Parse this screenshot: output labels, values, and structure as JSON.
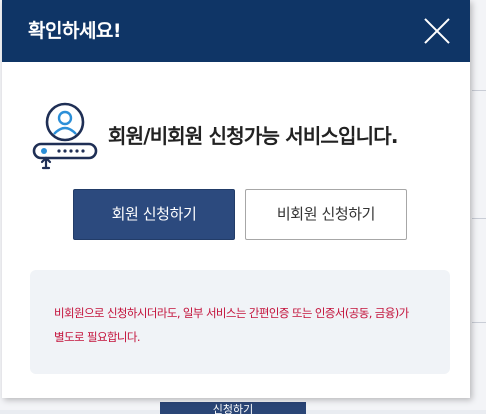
{
  "modal": {
    "title": "확인하세요!",
    "headline": "회원/비회원 신청가능 서비스입니다.",
    "member_button_label": "회원 신청하기",
    "nonmember_button_label": "비회원 신청하기",
    "notice_line1": "비회원으로 신청하시더라도, 일부 서비스는 간편인증 또는 인증서(공동, 금융)가",
    "notice_line2": "별도로 필요합니다."
  },
  "background": {
    "button_label": "신청하기"
  },
  "colors": {
    "header_bg": "#0f3566",
    "primary_button": "#2c4a7e",
    "notice_text": "#c3123b",
    "notice_bg": "#f0f3f7"
  },
  "icons": {
    "hero": "user-id-card-icon",
    "close": "close-icon"
  }
}
